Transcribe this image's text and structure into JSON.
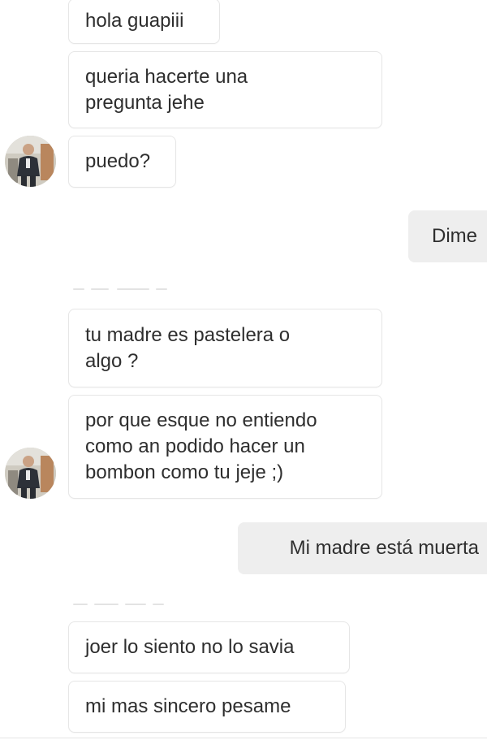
{
  "conversation": {
    "messages": [
      {
        "text": "hola guapiii",
        "from": "them"
      },
      {
        "text": "queria hacerte una\npregunta jehe",
        "from": "them"
      },
      {
        "text": "puedo?",
        "from": "them"
      },
      {
        "text": "Dime",
        "from": "me"
      },
      {
        "text": "tu madre es pastelera o\nalgo ?",
        "from": "them"
      },
      {
        "text": "por que esque no entiendo\ncomo an podido hacer un\nbombon como tu jeje ;)",
        "from": "them"
      },
      {
        "text": "Mi madre está muerta",
        "from": "me"
      },
      {
        "text": "joer lo siento no lo savia",
        "from": "them"
      },
      {
        "text": "mi mas sincero pesame",
        "from": "them"
      }
    ]
  },
  "avatar": {
    "icon": "contact-avatar-photo"
  },
  "colors": {
    "incoming_bubble": "#ffffff",
    "incoming_border": "#e6e6e6",
    "outgoing_bubble": "#eeeeee",
    "text": "#2e2e2e"
  }
}
